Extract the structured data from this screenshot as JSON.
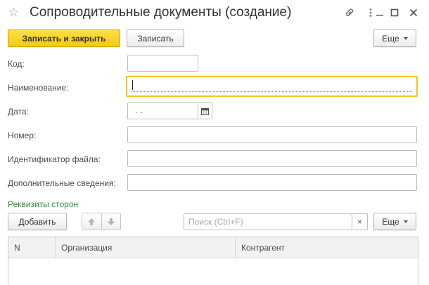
{
  "window": {
    "title": "Сопроводительные документы (создание)",
    "icons": [
      "star-icon",
      "link-icon",
      "more-icon",
      "minimize-icon",
      "maximize-icon",
      "close-icon"
    ]
  },
  "toolbar": {
    "save_close_label": "Записать и закрыть",
    "save_label": "Записать",
    "more_label": "Еще"
  },
  "form": {
    "code": {
      "label": "Код:",
      "value": ""
    },
    "name": {
      "label": "Наименование:",
      "value": ""
    },
    "date": {
      "label": "Дата:",
      "value": ". ."
    },
    "number": {
      "label": "Номер:",
      "value": ""
    },
    "file_id": {
      "label": "Идентификатор файла:",
      "value": ""
    },
    "extra": {
      "label": "Дополнительные сведения:",
      "value": ""
    }
  },
  "parties": {
    "section_title": "Реквизиты сторон",
    "add_label": "Добавить",
    "search_placeholder": "Поиск (Ctrl+F)",
    "clear_symbol": "×",
    "more_label": "Еще",
    "columns": [
      "N",
      "Организация",
      "Контрагент"
    ],
    "rows": []
  },
  "colors": {
    "primary_button": "#f5c913",
    "active_field_border": "#f2c523",
    "section_title": "#2e8b3a"
  }
}
